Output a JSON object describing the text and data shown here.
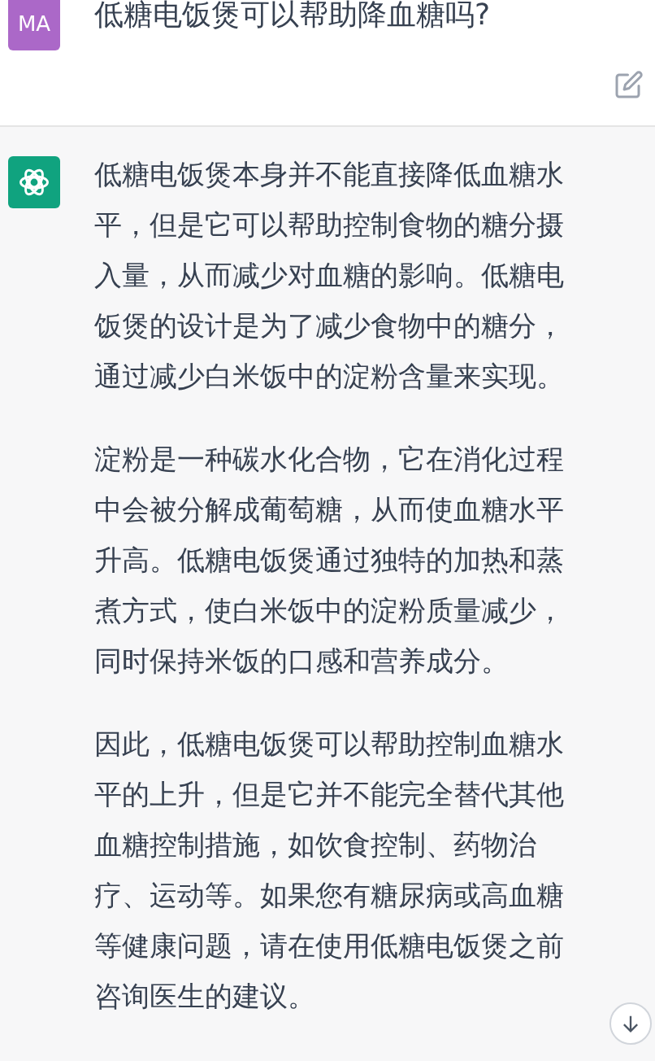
{
  "question": {
    "avatar": "MA",
    "text": "低糖电饭煲可以帮助降血糖吗?"
  },
  "answer": {
    "paragraphs": [
      "低糖电饭煲本身并不能直接降低血糖水平，但是它可以帮助控制食物的糖分摄入量，从而减少对血糖的影响。低糖电饭煲的设计是为了减少食物中的糖分，通过减少白米饭中的淀粉含量来实现。",
      "淀粉是一种碳水化合物，它在消化过程中会被分解成葡萄糖，从而使血糖水平升高。低糖电饭煲通过独特的加热和蒸煮方式，使白米饭中的淀粉质量减少，同时保持米饭的口感和营养成分。",
      "因此，低糖电饭煲可以帮助控制血糖水平的上升，但是它并不能完全替代其他血糖控制措施，如饮食控制、药物治疗、运动等。如果您有糖尿病或高血糖等健康问题，请在使用低糖电饭煲之前咨询医生的建议。"
    ]
  }
}
